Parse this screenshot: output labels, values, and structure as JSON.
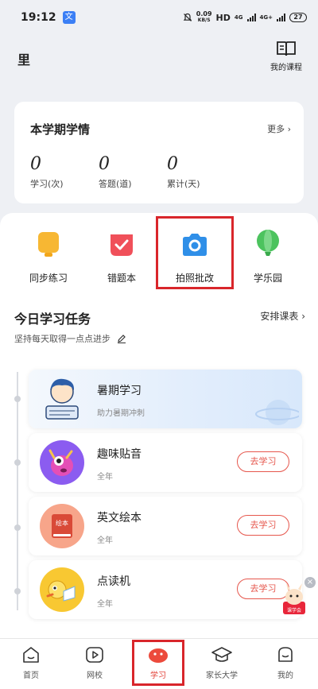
{
  "status_bar": {
    "time": "19:12",
    "app_badge": "文",
    "net_speed": "0.09",
    "net_unit": "KB/S",
    "hd": "HD",
    "net1": "4G",
    "net2": "4G+",
    "battery": "27"
  },
  "header": {
    "location": "里",
    "course_label": "我的课程"
  },
  "semester": {
    "title": "本学期学情",
    "more": "更多",
    "stats": [
      {
        "value": "0",
        "label": "学习(次)"
      },
      {
        "value": "0",
        "label": "答题(道)"
      },
      {
        "value": "0",
        "label": "累计(天)"
      }
    ]
  },
  "entries": [
    {
      "label": "同步练习",
      "icon": "practice-icon",
      "color": "#f7b733"
    },
    {
      "label": "错题本",
      "icon": "mistake-book-icon",
      "color": "#f0505a"
    },
    {
      "label": "拍照批改",
      "icon": "camera-icon",
      "color": "#2f8fe8"
    },
    {
      "label": "学乐园",
      "icon": "balloon-icon",
      "color": "#4cc35e"
    }
  ],
  "tasks": {
    "title": "今日学习任务",
    "arrange": "安排课表",
    "subtitle": "坚持每天取得一点点进步",
    "items": [
      {
        "name": "暑期学习",
        "sub": "助力暑期冲刺"
      },
      {
        "name": "趣味贴音",
        "sub": "全年",
        "button": "去学习"
      },
      {
        "name": "英文绘本",
        "sub": "全年",
        "button": "去学习",
        "book_label": "绘本"
      },
      {
        "name": "点读机",
        "sub": "全年",
        "button": "去学习"
      }
    ]
  },
  "float_ad": {
    "label": "课学会"
  },
  "tabs": [
    {
      "label": "首页",
      "icon": "home-icon"
    },
    {
      "label": "网校",
      "icon": "play-icon"
    },
    {
      "label": "学习",
      "icon": "study-icon",
      "active": true
    },
    {
      "label": "家长大学",
      "icon": "graduation-cap-icon"
    },
    {
      "label": "我的",
      "icon": "profile-icon"
    }
  ]
}
